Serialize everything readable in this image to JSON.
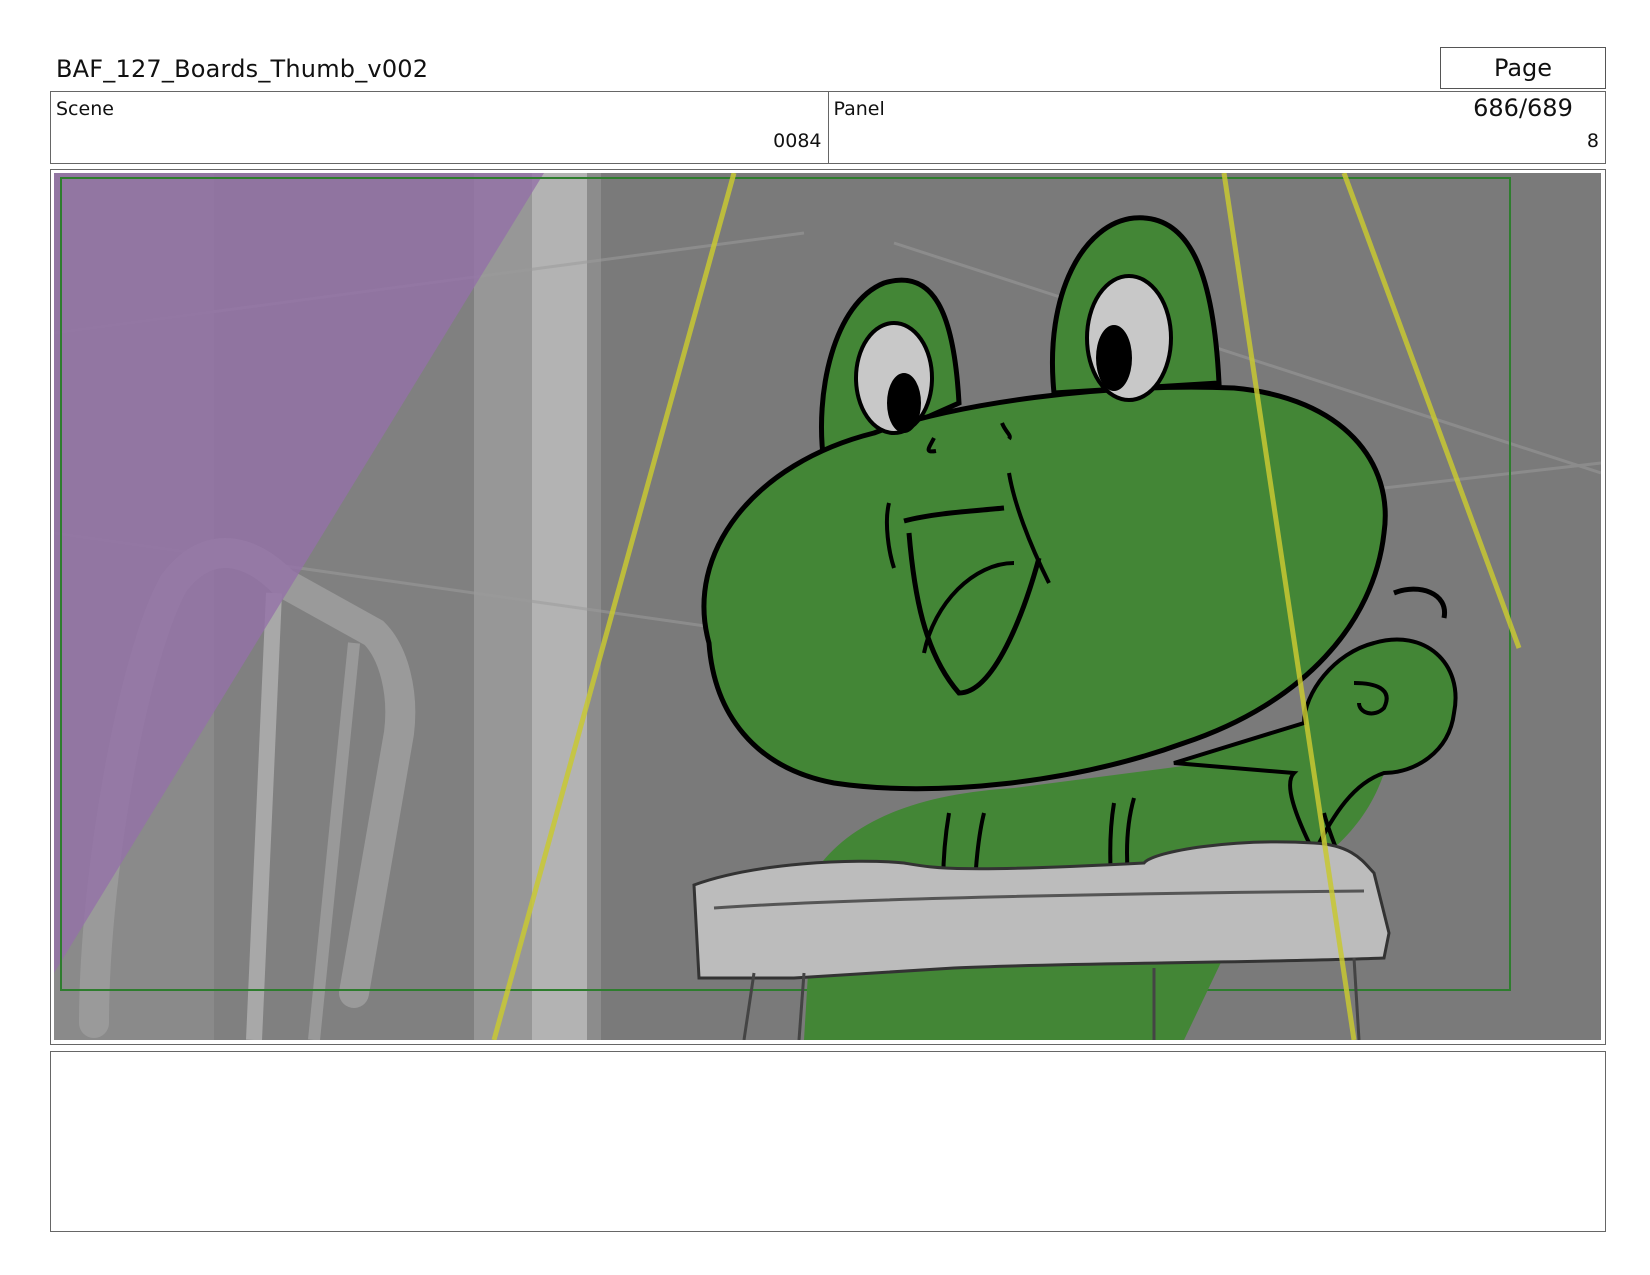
{
  "header": {
    "title": "BAF_127_Boards_Thumb_v002",
    "page_label": "Page 686/689"
  },
  "scene": {
    "label": "Scene",
    "value": "0084"
  },
  "panel": {
    "label": "Panel",
    "value": "8"
  },
  "drawing": {
    "description_icon": "frog-storyboard-drawing",
    "colors": {
      "background": "#7a7a7a",
      "frog_green": "#438636",
      "line": "#000000",
      "purple_overlay": "#9370a8",
      "guide_yellow": "#c8c832",
      "safe_frame": "#2e7d2e",
      "desk": "#bcbcbc"
    }
  },
  "notes": {
    "text": ""
  }
}
